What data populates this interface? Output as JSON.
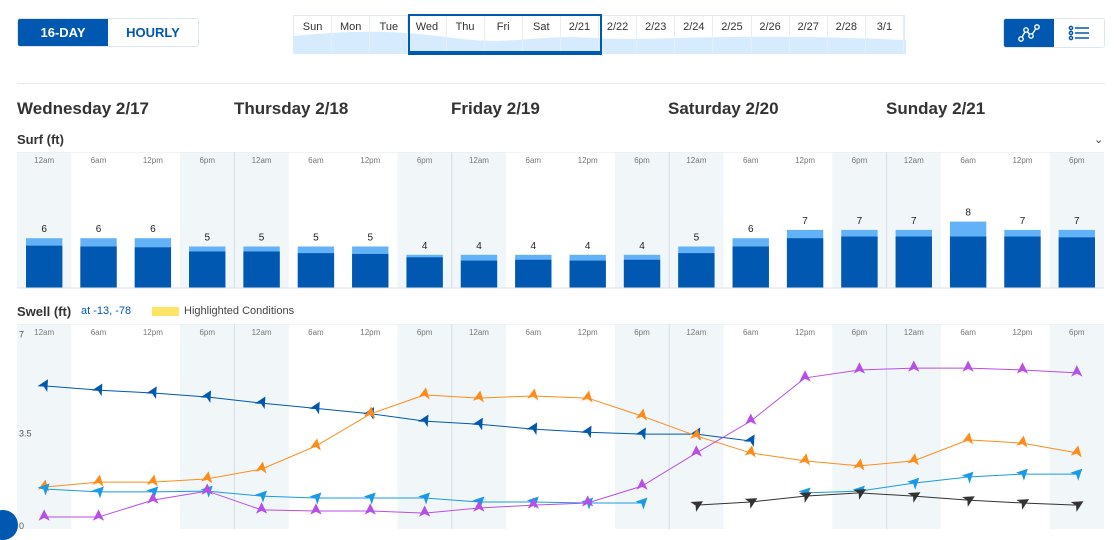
{
  "toggle": {
    "options": [
      "16-DAY",
      "HOURLY"
    ],
    "selected": "16-DAY"
  },
  "date_strip": {
    "cells": [
      "Sun",
      "Mon",
      "Tue",
      "Wed",
      "Thu",
      "Fri",
      "Sat",
      "2/21",
      "2/22",
      "2/23",
      "2/24",
      "2/25",
      "2/26",
      "2/27",
      "2/28",
      "3/1"
    ],
    "selected_range": [
      "Wed",
      "2/21"
    ]
  },
  "view_buttons": {
    "graph": "graph-icon",
    "list": "list-icon",
    "selected": "graph"
  },
  "days": [
    "Wednesday 2/17",
    "Thursday 2/18",
    "Friday 2/19",
    "Saturday 2/20",
    "Sunday 2/21"
  ],
  "surf": {
    "title": "Surf (ft)",
    "collapse_icon": "chevron-down-icon"
  },
  "swell": {
    "title": "Swell (ft)",
    "location": "at -13, -78",
    "legend": "Highlighted Conditions",
    "legend_color": "#ffe566"
  },
  "time_labels": [
    "12am",
    "6am",
    "12pm",
    "6pm"
  ],
  "colors": {
    "primary": "#0058b0",
    "surf_light": "#63b1f7",
    "shade": "#f1f6f9"
  },
  "chart_data": [
    {
      "type": "bar",
      "title": "Surf (ft)",
      "categories_per_day": [
        "12am",
        "6am",
        "12pm",
        "6pm"
      ],
      "labels": [
        6,
        6,
        6,
        5,
        5,
        5,
        5,
        4,
        4,
        4,
        4,
        4,
        5,
        6,
        7,
        7,
        7,
        8,
        7,
        7
      ],
      "max": [
        6,
        6,
        6,
        5,
        5,
        5,
        5,
        4,
        4,
        4,
        4,
        4,
        5,
        6,
        7,
        7,
        7,
        8,
        7,
        7
      ],
      "min": [
        5.1,
        5,
        4.9,
        4.4,
        4.4,
        4.2,
        4.1,
        3.7,
        3.3,
        3.4,
        3.3,
        3.4,
        4.2,
        5,
        6,
        6.2,
        6.2,
        6.2,
        6.2,
        6.1
      ]
    },
    {
      "type": "line",
      "title": "Swell (ft)",
      "ylim": [
        0,
        7
      ],
      "yticks": [
        "0",
        "3.5",
        "7"
      ],
      "series": [
        {
          "color": "#0058b0",
          "values": [
            5.25,
            5.09,
            4.98,
            4.83,
            4.6,
            4.4,
            4.2,
            3.92,
            3.8,
            3.62,
            3.5,
            3.43,
            3.43,
            3.17,
            null,
            null,
            null,
            null,
            null,
            null
          ]
        },
        {
          "color": "#ff8c1a",
          "values": [
            1.43,
            1.62,
            1.62,
            1.74,
            2.11,
            2.98,
            4.19,
            4.91,
            4.79,
            4.87,
            4.79,
            4.11,
            3.36,
            2.72,
            2.42,
            2.23,
            2.42,
            3.21,
            3.09,
            2.72
          ]
        },
        {
          "color": "#1a9ae6",
          "values": [
            1.36,
            1.25,
            1.25,
            1.28,
            1.09,
            1.02,
            1.02,
            1.02,
            0.87,
            0.87,
            0.83,
            0.83,
            null,
            null,
            1.21,
            1.28,
            1.58,
            1.81,
            1.92,
            1.92
          ]
        },
        {
          "color": "#b84ee8",
          "values": [
            0.3,
            0.3,
            0.94,
            1.28,
            0.57,
            0.53,
            0.53,
            0.45,
            0.64,
            0.75,
            0.83,
            1.47,
            2.72,
            3.92,
            5.55,
            5.85,
            5.92,
            5.92,
            5.85,
            5.74
          ]
        },
        {
          "color": "#333333",
          "values": [
            null,
            null,
            null,
            null,
            null,
            null,
            null,
            null,
            null,
            null,
            null,
            null,
            0.75,
            0.87,
            1.09,
            1.21,
            1.09,
            0.94,
            0.83,
            0.75
          ]
        }
      ]
    }
  ]
}
